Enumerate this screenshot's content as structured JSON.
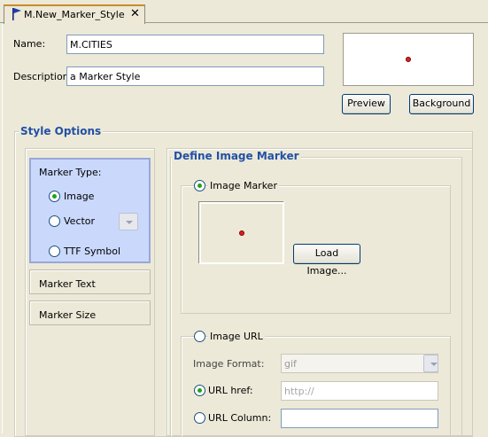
{
  "tab": {
    "title": "M.New_Marker_Style"
  },
  "form": {
    "name_label": "Name:",
    "name_value": "M.CITIES",
    "description_label": "Description:",
    "description_value": "a Marker Style"
  },
  "preview": {
    "preview_button": "Preview",
    "background_button": "Background"
  },
  "style_options": {
    "title": "Style Options",
    "marker_type": {
      "label": "Marker Type:",
      "options": [
        "Image",
        "Vector",
        "TTF Symbol"
      ],
      "selected": "Image"
    },
    "marker_text": "Marker Text",
    "marker_size": "Marker Size"
  },
  "define_image_marker": {
    "title": "Define Image Marker",
    "image_marker_label": "Image Marker",
    "load_image_button": "Load Image...",
    "image_url_label": "Image URL",
    "image_format_label": "Image Format:",
    "image_format_value": "gif",
    "url_href_label": "URL href:",
    "url_href_placeholder": "http://",
    "url_column_label": "URL Column:",
    "url_column_value": ""
  },
  "colors": {
    "marker_dot": "#e02020",
    "group_title": "#2250a6",
    "selected_panel": "#cad8fc"
  },
  "icons": {
    "tab": "flag-icon",
    "close": "close-icon"
  }
}
